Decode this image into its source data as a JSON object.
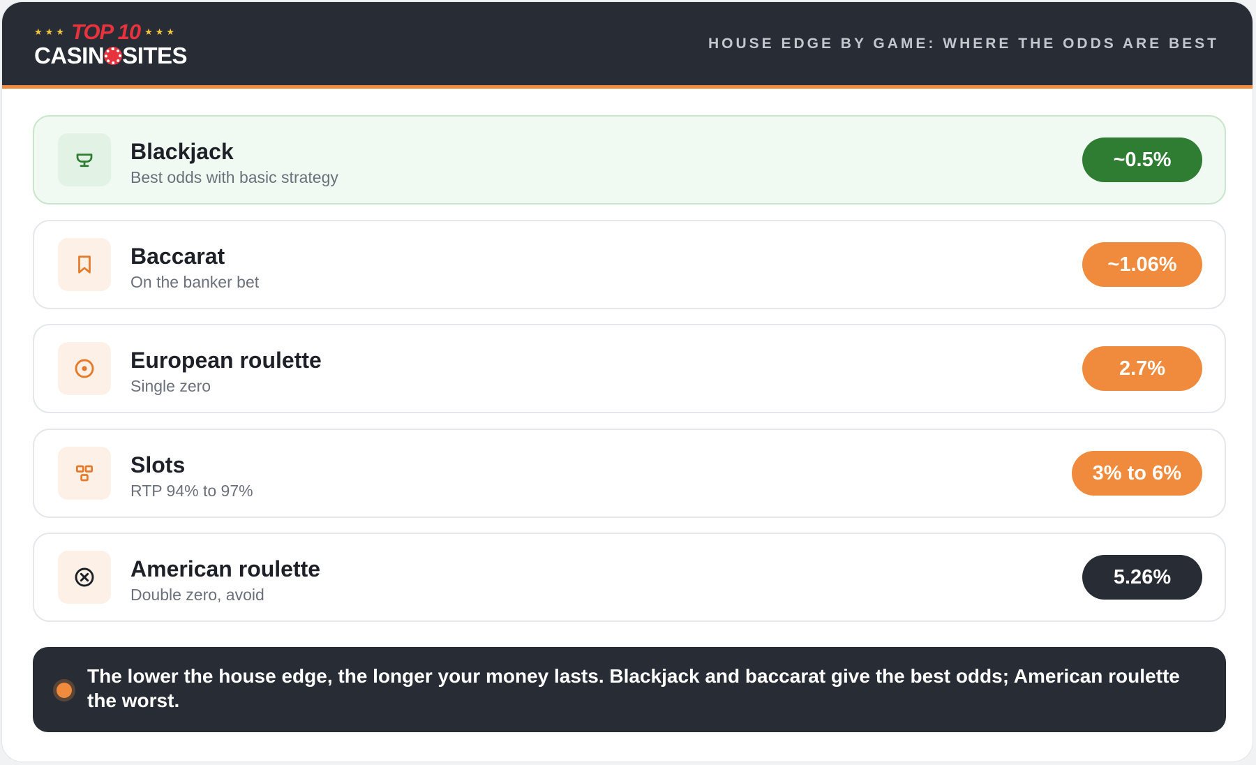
{
  "header": {
    "logo": {
      "top": "TOP 10",
      "casino": "CASIN",
      "sites": "SITES",
      "stars": "★★★"
    },
    "title": "HOUSE EDGE BY GAME: WHERE THE ODDS ARE BEST"
  },
  "colors": {
    "accent": "#f08a3c",
    "best": "#2e7d32",
    "dark": "#272c35",
    "icon_best": "#2e7d32",
    "icon_orange": "#e57a2a",
    "icon_dark": "#1d2026"
  },
  "games": [
    {
      "name": "Blackjack",
      "note": "Best odds with basic strategy",
      "edge": "~0.5%",
      "icon": "trophy-icon",
      "tone": "best"
    },
    {
      "name": "Baccarat",
      "note": "On the banker bet",
      "edge": "~1.06%",
      "icon": "bookmark-icon",
      "tone": "orange"
    },
    {
      "name": "European roulette",
      "note": "Single zero",
      "edge": "2.7%",
      "icon": "target-icon",
      "tone": "orange"
    },
    {
      "name": "Slots",
      "note": "RTP 94% to 97%",
      "edge": "3% to 6%",
      "icon": "slots-grid-icon",
      "tone": "orange"
    },
    {
      "name": "American roulette",
      "note": "Double zero, avoid",
      "edge": "5.26%",
      "icon": "x-circle-icon",
      "tone": "dark"
    }
  ],
  "footer_note": "The lower the house edge, the longer your money lasts. Blackjack and baccarat give the best odds; American roulette the worst."
}
